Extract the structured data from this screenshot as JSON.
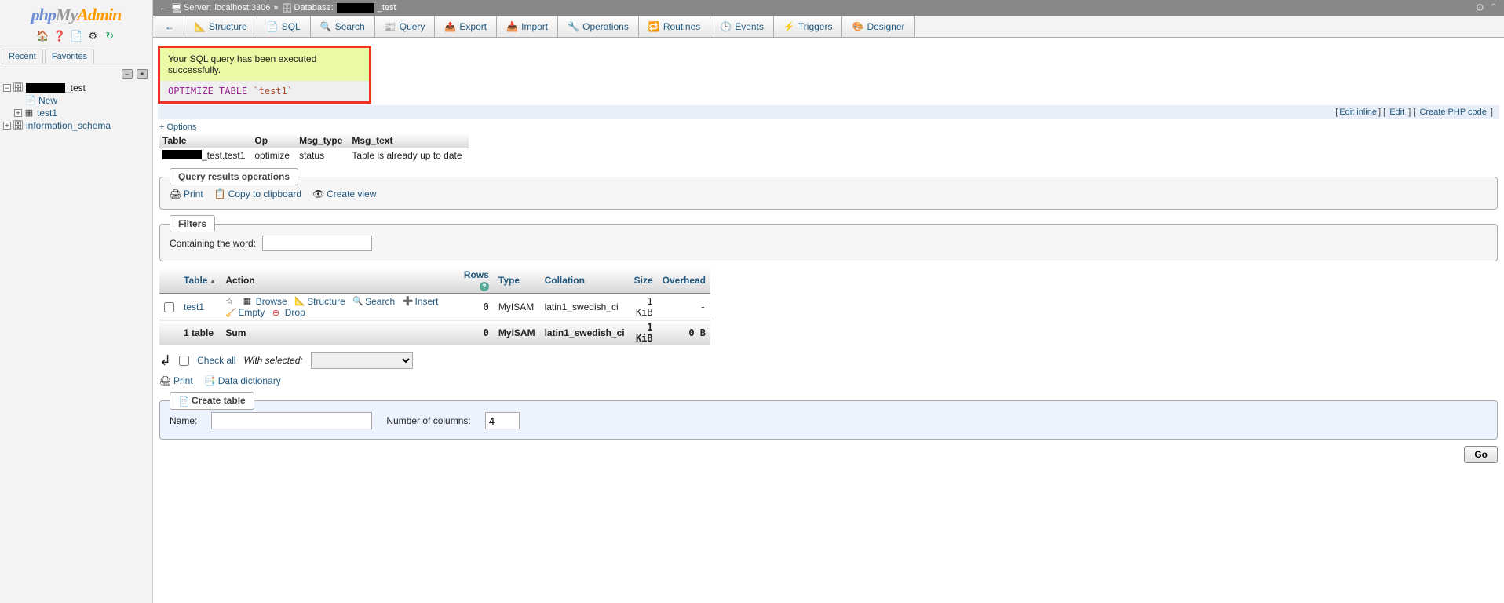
{
  "logo": {
    "p1": "php",
    "p2": "My",
    "p3": "Admin"
  },
  "sidebar": {
    "icons": [
      "home-icon",
      "help-icon",
      "sql-icon",
      "gear-icon",
      "reload-icon"
    ],
    "tabs": [
      "Recent",
      "Favorites"
    ],
    "nodes": {
      "db_suffix": "_test",
      "new": "New",
      "table1": "test1",
      "info_schema": "information_schema"
    }
  },
  "breadcrumb": {
    "server_label": "Server:",
    "server_value": "localhost:3306",
    "sep": "»",
    "db_label": "Database:",
    "db_suffix": "_test"
  },
  "tabs": [
    {
      "icon": "📐",
      "label": "Structure"
    },
    {
      "icon": "📄",
      "label": "SQL"
    },
    {
      "icon": "🔍",
      "label": "Search"
    },
    {
      "icon": "📰",
      "label": "Query"
    },
    {
      "icon": "📤",
      "label": "Export"
    },
    {
      "icon": "📥",
      "label": "Import"
    },
    {
      "icon": "🔧",
      "label": "Operations"
    },
    {
      "icon": "🔁",
      "label": "Routines"
    },
    {
      "icon": "🕒",
      "label": "Events"
    },
    {
      "icon": "⚡",
      "label": "Triggers"
    },
    {
      "icon": "🎨",
      "label": "Designer"
    }
  ],
  "success": {
    "message": "Your SQL query has been executed successfully.",
    "sql_kw1": "OPTIMIZE",
    "sql_kw2": "TABLE",
    "sql_id": "`test1`"
  },
  "links": {
    "edit_inline": "Edit inline",
    "edit": "Edit",
    "create_php": "Create PHP code"
  },
  "options_link": "+ Options",
  "result": {
    "headers": [
      "Table",
      "Op",
      "Msg_type",
      "Msg_text"
    ],
    "row": {
      "table_suffix": "_test.test1",
      "op": "optimize",
      "msg_type": "status",
      "msg_text": "Table is already up to date"
    }
  },
  "query_ops": {
    "legend": "Query results operations",
    "print": "Print",
    "copy": "Copy to clipboard",
    "create_view": "Create view"
  },
  "filters": {
    "legend": "Filters",
    "label": "Containing the word:"
  },
  "tables": {
    "headers": {
      "table": "Table",
      "action": "Action",
      "rows": "Rows",
      "type": "Type",
      "collation": "Collation",
      "size": "Size",
      "overhead": "Overhead"
    },
    "row": {
      "name": "test1",
      "actions": {
        "browse": "Browse",
        "structure": "Structure",
        "search": "Search",
        "insert": "Insert",
        "empty": "Empty",
        "drop": "Drop"
      },
      "rows": "0",
      "type": "MyISAM",
      "collation": "latin1_swedish_ci",
      "size": "1 KiB",
      "overhead": "-"
    },
    "sum": {
      "label": "1 table",
      "sum": "Sum",
      "rows": "0",
      "type": "MyISAM",
      "collation": "latin1_swedish_ci",
      "size": "1 KiB",
      "overhead": "0 B"
    }
  },
  "checkall": {
    "label": "Check all",
    "with_selected": "With selected:"
  },
  "print_dict": {
    "print": "Print",
    "dict": "Data dictionary"
  },
  "create_table": {
    "legend": "Create table",
    "name_label": "Name:",
    "cols_label": "Number of columns:",
    "cols_value": "4"
  },
  "go": "Go"
}
